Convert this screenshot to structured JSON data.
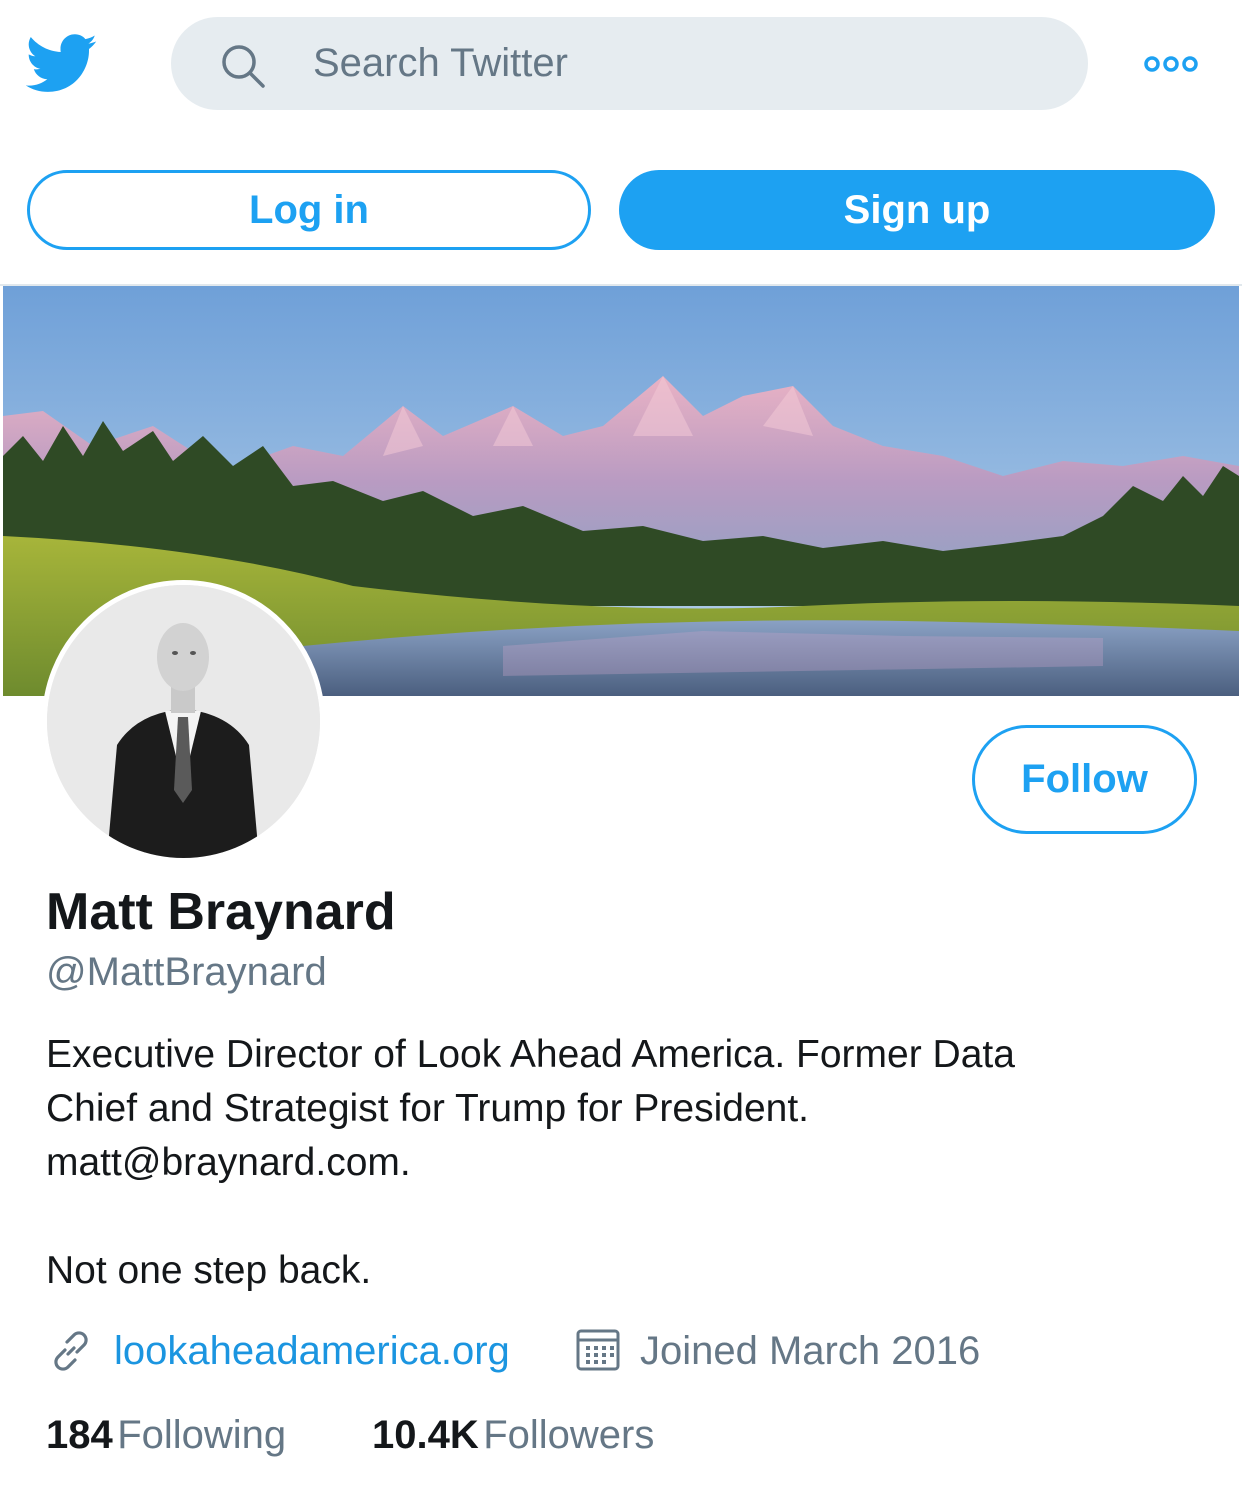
{
  "header": {
    "logo_icon": "twitter-bird-icon",
    "search_placeholder": "Search Twitter",
    "search_icon": "search-icon",
    "more_icon": "more-dots-icon"
  },
  "auth": {
    "login_label": "Log in",
    "signup_label": "Sign up"
  },
  "profile": {
    "banner_icon": "mountain-landscape-banner",
    "avatar_icon": "profile-photo",
    "follow_label": "Follow",
    "name": "Matt Braynard",
    "handle": "@MattBraynard",
    "bio_lines": [
      "Executive Director of Look Ahead America. Former Data",
      "Chief and Strategist for Trump for President.",
      "matt@braynard.com.",
      "Not one step back."
    ],
    "website": "lookaheadamerica.org",
    "joined": "Joined March 2016",
    "following_count": "184",
    "following_label": "Following",
    "followers_count": "10.4K",
    "followers_label": "Followers"
  },
  "colors": {
    "accent": "#1da1f2",
    "link": "#1b95e0",
    "secondary_text": "#657786",
    "search_bg": "#e6ecf0"
  }
}
